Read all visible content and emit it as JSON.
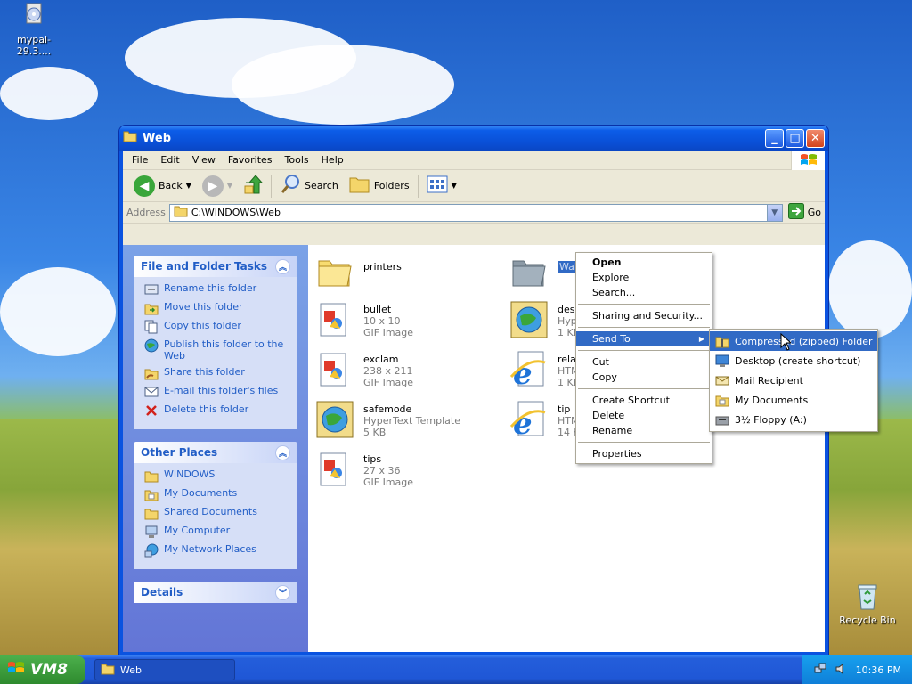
{
  "desktop": {
    "icons": [
      {
        "label": "mypal-29.3...."
      },
      {
        "label": "Recycle Bin"
      }
    ]
  },
  "window": {
    "title": "Web",
    "menu": [
      "File",
      "Edit",
      "View",
      "Favorites",
      "Tools",
      "Help"
    ],
    "toolbar": {
      "back": "Back",
      "search": "Search",
      "folders": "Folders"
    },
    "address": {
      "label": "Address",
      "value": "C:\\WINDOWS\\Web",
      "go": "Go"
    }
  },
  "taskpane": {
    "file_tasks": {
      "title": "File and Folder Tasks",
      "items": [
        "Rename this folder",
        "Move this folder",
        "Copy this folder",
        "Publish this folder to the Web",
        "Share this folder",
        "E-mail this folder's files",
        "Delete this folder"
      ]
    },
    "other_places": {
      "title": "Other Places",
      "items": [
        "WINDOWS",
        "My Documents",
        "Shared Documents",
        "My Computer",
        "My Network Places"
      ]
    },
    "details": {
      "title": "Details"
    }
  },
  "files": [
    {
      "name": "printers",
      "sub1": "",
      "sub2": "",
      "icon": "folder-icon"
    },
    {
      "name": "Wallpaper",
      "sub1": "",
      "sub2": "",
      "icon": "folder-icon"
    },
    {
      "name": "bullet",
      "sub1": "10 x 10",
      "sub2": "GIF Image",
      "icon": "gif-image-icon"
    },
    {
      "name": "desk",
      "sub1": "Hype",
      "sub2": "1 KB",
      "icon": "hypertext-template-icon"
    },
    {
      "name": "exclam",
      "sub1": "238 x 211",
      "sub2": "GIF Image",
      "icon": "gif-image-icon"
    },
    {
      "name": "relate",
      "sub1": "HTML",
      "sub2": "1 KB",
      "icon": "ie-document-icon"
    },
    {
      "name": "safemode",
      "sub1": "HyperText Template",
      "sub2": "5 KB",
      "icon": "hypertext-template-icon"
    },
    {
      "name": "tip",
      "sub1": "HTML",
      "sub2": "14 K",
      "icon": "ie-document-icon"
    },
    {
      "name": "tips",
      "sub1": "27 x 36",
      "sub2": "GIF Image",
      "icon": "gif-image-icon"
    }
  ],
  "context_menu": {
    "open": "Open",
    "explore": "Explore",
    "search": "Search...",
    "sharing": "Sharing and Security...",
    "send_to": "Send To",
    "cut": "Cut",
    "copy": "Copy",
    "create_shortcut": "Create Shortcut",
    "delete": "Delete",
    "rename": "Rename",
    "properties": "Properties"
  },
  "send_to_menu": [
    "Compressed (zipped) Folder",
    "Desktop (create shortcut)",
    "Mail Recipient",
    "My Documents",
    "3½ Floppy (A:)"
  ],
  "taskbar": {
    "start": "VM8",
    "task": "Web",
    "clock": "10:36 PM"
  },
  "colors": {
    "selection": "#316ac5",
    "link": "#215dc6",
    "titlebar": "#0a4fd6"
  }
}
